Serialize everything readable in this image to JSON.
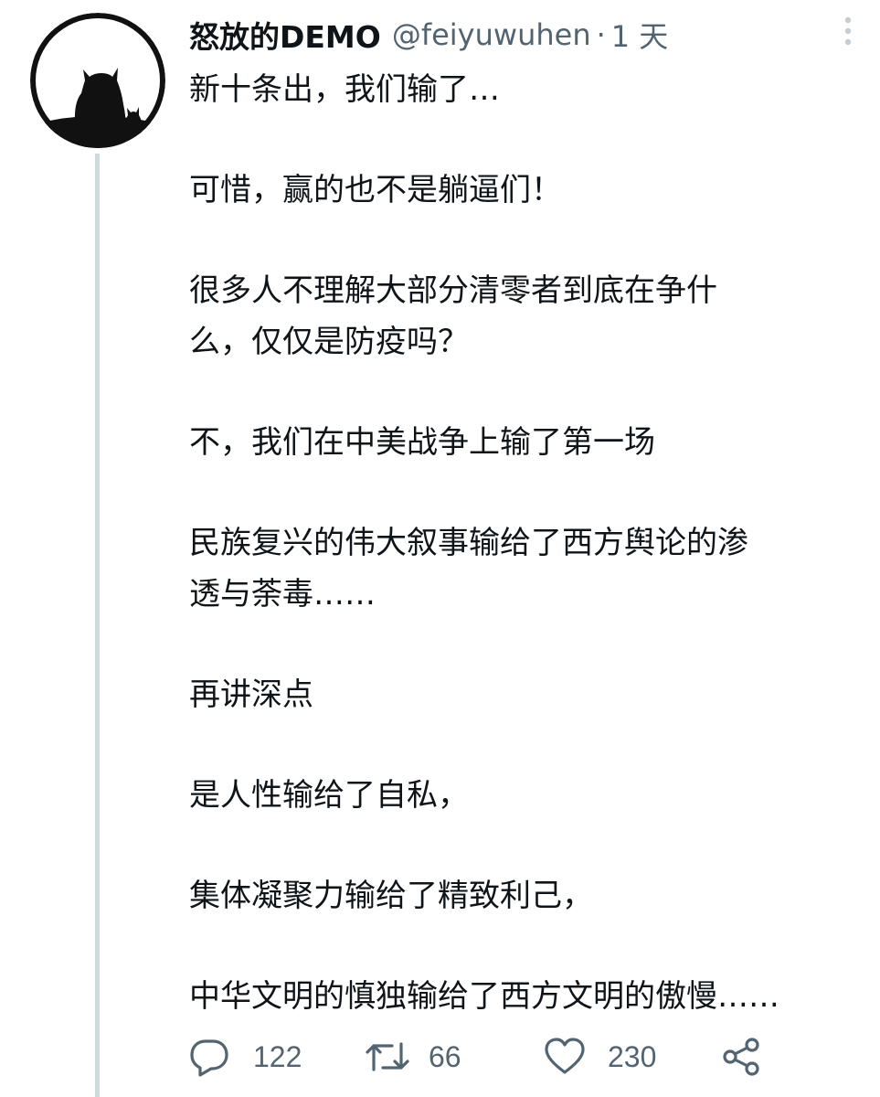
{
  "tweet": {
    "display_name": "怒放的DEMO",
    "handle": "@feiyuwuhen",
    "separator": "·",
    "time": "1 天",
    "paragraphs": [
      "新十条出，我们输了…",
      "可惜，赢的也不是躺逼们！",
      "很多人不理解大部分清零者到底在争什\n么，仅仅是防疫吗？",
      "不，我们在中美战争上输了第一场",
      "民族复兴的伟大叙事输给了西方舆论的渗\n透与荼毒……",
      "再讲深点",
      "是人性输给了自私，",
      "集体凝聚力输给了精致利己，",
      "中华文明的慎独输给了西方文明的傲慢……"
    ],
    "actions": {
      "reply_count": "122",
      "retweet_count": "66",
      "like_count": "230"
    }
  },
  "icons": {
    "avatar": "totoro-silhouette-avatar",
    "more": "more-vertical-icon",
    "reply": "reply-icon",
    "retweet": "retweet-icon",
    "like": "heart-icon",
    "share": "share-icon"
  },
  "colors": {
    "text": "#0f1419",
    "secondary": "#536471",
    "thread_line": "#cfd9de"
  }
}
